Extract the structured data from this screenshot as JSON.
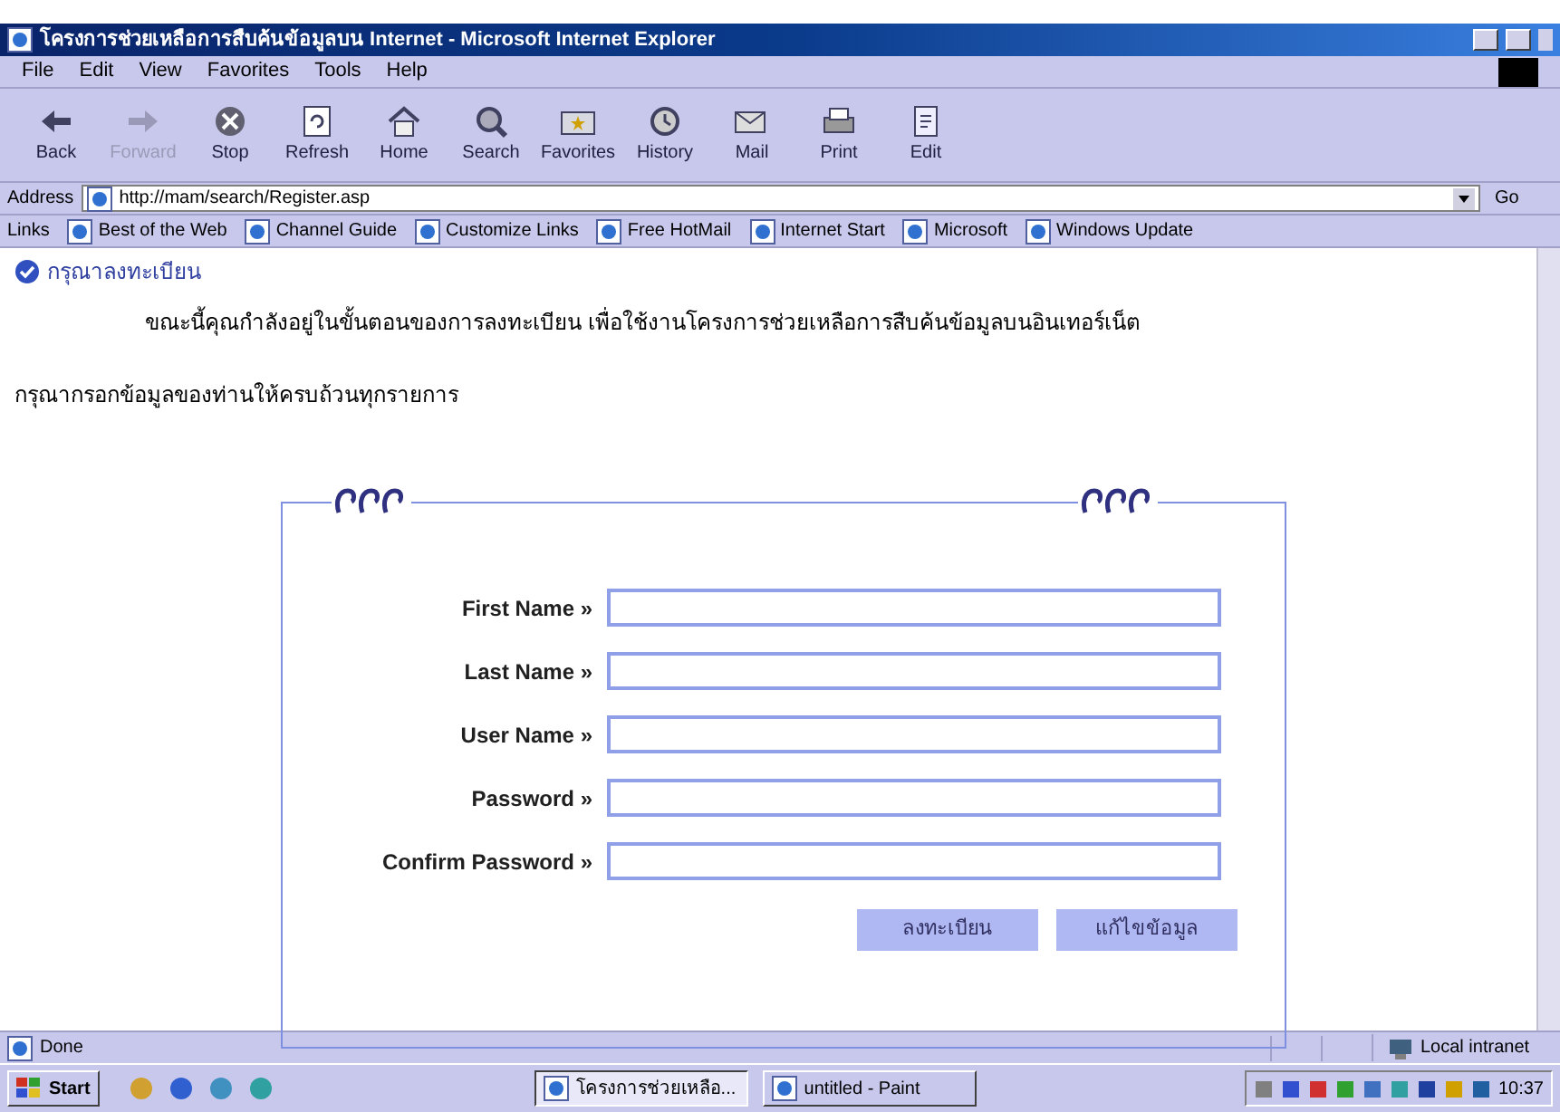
{
  "window": {
    "title": "โครงการช่วยเหลือการสืบค้นข้อมูลบน Internet - Microsoft Internet Explorer"
  },
  "menu": [
    "File",
    "Edit",
    "View",
    "Favorites",
    "Tools",
    "Help"
  ],
  "toolbar": [
    {
      "label": "Back",
      "kind": "back",
      "disabled": false
    },
    {
      "label": "Forward",
      "kind": "forward",
      "disabled": true
    },
    {
      "label": "Stop",
      "kind": "stop",
      "disabled": false
    },
    {
      "label": "Refresh",
      "kind": "refresh",
      "disabled": false
    },
    {
      "label": "Home",
      "kind": "home",
      "disabled": false
    },
    {
      "label": "Search",
      "kind": "search",
      "disabled": false
    },
    {
      "label": "Favorites",
      "kind": "favorites",
      "disabled": false
    },
    {
      "label": "History",
      "kind": "history",
      "disabled": false
    },
    {
      "label": "Mail",
      "kind": "mail",
      "disabled": false
    },
    {
      "label": "Print",
      "kind": "print",
      "disabled": false
    },
    {
      "label": "Edit",
      "kind": "edit",
      "disabled": false
    }
  ],
  "address": {
    "label": "Address",
    "value": "http://mam/search/Register.asp",
    "go": "Go"
  },
  "links": {
    "label": "Links",
    "items": [
      "Best of the Web",
      "Channel Guide",
      "Customize Links",
      "Free HotMail",
      "Internet Start",
      "Microsoft",
      "Windows Update"
    ]
  },
  "page": {
    "heading": "กรุณาลงทะเบียน",
    "intro": "ขณะนี้คุณกำลังอยู่ในขั้นตอนของการลงทะเบียน เพื่อใช้งานโครงการช่วยเหลือการสืบค้นข้อมูลบนอินเทอร์เน็ต",
    "instruction": "กรุณากรอกข้อมูลของท่านให้ครบถ้วนทุกรายการ",
    "fields": [
      {
        "label": "First Name »"
      },
      {
        "label": "Last Name »"
      },
      {
        "label": "User Name »"
      },
      {
        "label": "Password »"
      },
      {
        "label": "Confirm Password »"
      }
    ],
    "buttons": [
      "ลงทะเบียน",
      "แก้ไขข้อมูล"
    ]
  },
  "status_bar": {
    "text": "Done",
    "zone": "Local intranet"
  },
  "taskbar": {
    "start": "Start",
    "tasks": [
      {
        "label": "โครงการช่วยเหลือ...",
        "selected": true
      },
      {
        "label": "untitled - Paint",
        "selected": false
      }
    ],
    "clock": "10:37"
  }
}
